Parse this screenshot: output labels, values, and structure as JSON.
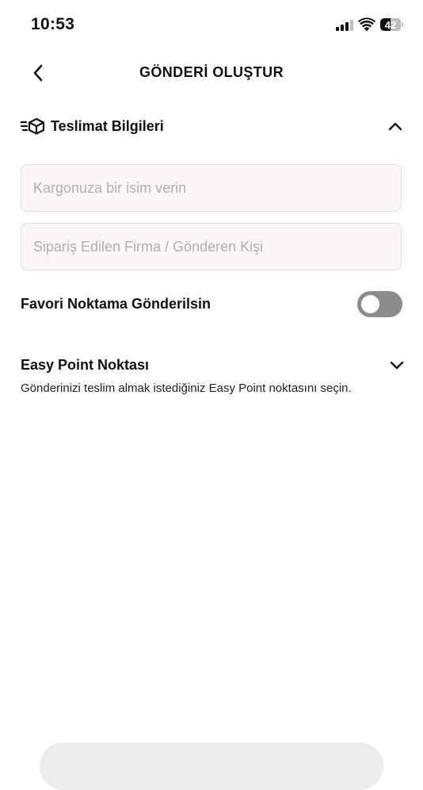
{
  "status_bar": {
    "time": "10:53",
    "battery": "42"
  },
  "header": {
    "title": "GÖNDERİ OLUŞTUR"
  },
  "section": {
    "title": "Teslimat Bilgileri"
  },
  "form": {
    "name_placeholder": "Kargonuza bir isim verin",
    "sender_placeholder": "Sipariş Edilen Firma / Gönderen Kişi",
    "favorite_label": "Favori Noktama Gönderilsin",
    "favorite_enabled": false
  },
  "easy_point": {
    "title": "Easy Point Noktası",
    "description": "Gönderinizi teslim almak istediğiniz Easy Point noktasını seçin."
  },
  "colors": {
    "toggle_off": "#8c8c8c",
    "input_bg": "#faf6f6",
    "input_border": "#e4dcdc",
    "placeholder": "#b3aeae"
  }
}
